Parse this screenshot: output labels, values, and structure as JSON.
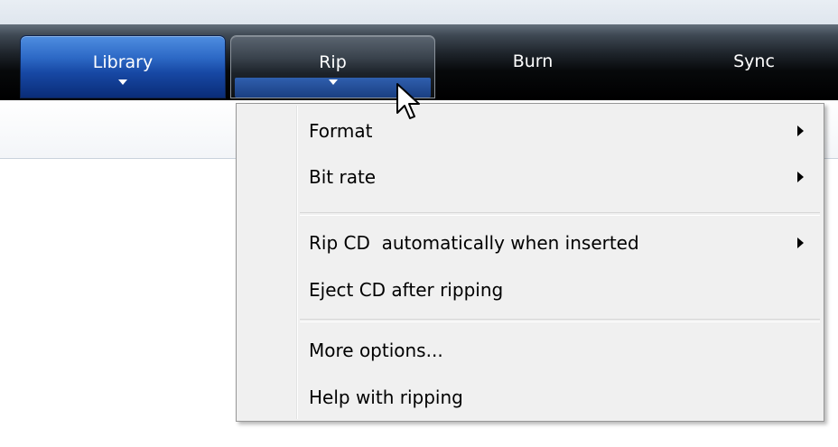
{
  "toolbar": {
    "tabs": [
      {
        "id": "library",
        "label": "Library",
        "has_dropdown": true,
        "state": "active"
      },
      {
        "id": "rip",
        "label": "Rip",
        "has_dropdown": true,
        "state": "menu-open"
      },
      {
        "id": "burn",
        "label": "Burn",
        "has_dropdown": false,
        "state": "normal"
      },
      {
        "id": "sync",
        "label": "Sync",
        "has_dropdown": false,
        "state": "normal"
      }
    ]
  },
  "rip_menu": {
    "items": [
      {
        "label": "Format",
        "has_submenu": true
      },
      {
        "label": "Bit rate",
        "has_submenu": true
      },
      {
        "label": "Rip CD  automatically when inserted",
        "has_submenu": true
      },
      {
        "label": "Eject CD after ripping",
        "has_submenu": false
      },
      {
        "label": "More options...",
        "has_submenu": false
      },
      {
        "label": "Help with ripping",
        "has_submenu": false
      }
    ]
  },
  "icons": {
    "tab_dropdown": "triangle-down-icon",
    "submenu": "triangle-right-icon",
    "cursor": "mouse-pointer-icon"
  },
  "colors": {
    "library_tab": "#2d69c6",
    "toolbar_dark": "#000000",
    "menu_background": "#f0f0f0"
  }
}
